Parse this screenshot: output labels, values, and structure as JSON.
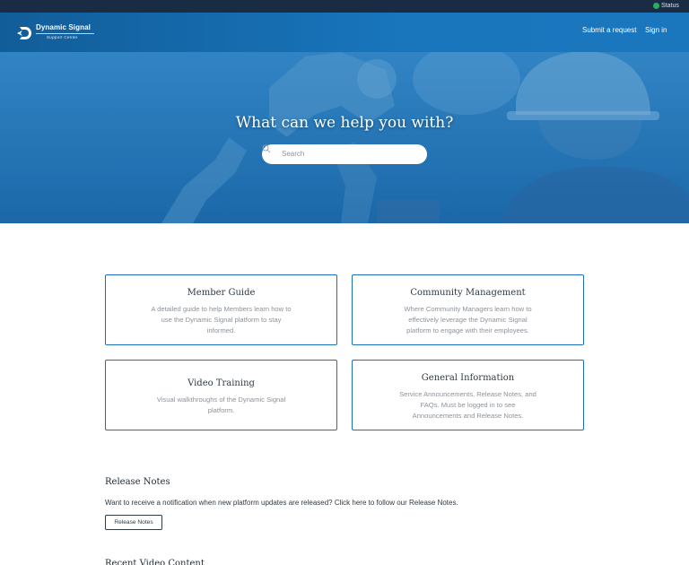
{
  "status_bar": {
    "label": "Status",
    "color": "#27ae60"
  },
  "header": {
    "brand_name": "Dynamic Signal",
    "brand_sub": "Support Center",
    "nav": {
      "submit": "Submit a request",
      "signin": "Sign in"
    },
    "background": "#1a77be"
  },
  "hero": {
    "title": "What can we help you with?",
    "search": {
      "placeholder": "Search",
      "icon": "search-icon"
    }
  },
  "cards": [
    {
      "title": "Member Guide",
      "description": "A detailed guide to help Members learn how to use the Dynamic Signal platform to stay informed."
    },
    {
      "title": "Community Management",
      "description": "Where Community Managers learn how to effectively leverage the Dynamic Signal platform to engage with their employees."
    },
    {
      "title": "Video Training",
      "description": "Visual walkthroughs of the Dynamic Signal platform."
    },
    {
      "title": "General Information",
      "description": "Service Announcements, Release Notes, and FAQs. Must be logged in to see Announcements and Release Notes."
    }
  ],
  "release_notes": {
    "heading": "Release Notes",
    "text": "Want to receive a notification when new platform updates are released? Click here to follow our Release Notes.",
    "button": "Release Notes"
  },
  "recent_video": {
    "heading": "Recent Video Content"
  },
  "colors": {
    "accent": "#1c6fb8",
    "top_bar": "#1a2b44"
  }
}
